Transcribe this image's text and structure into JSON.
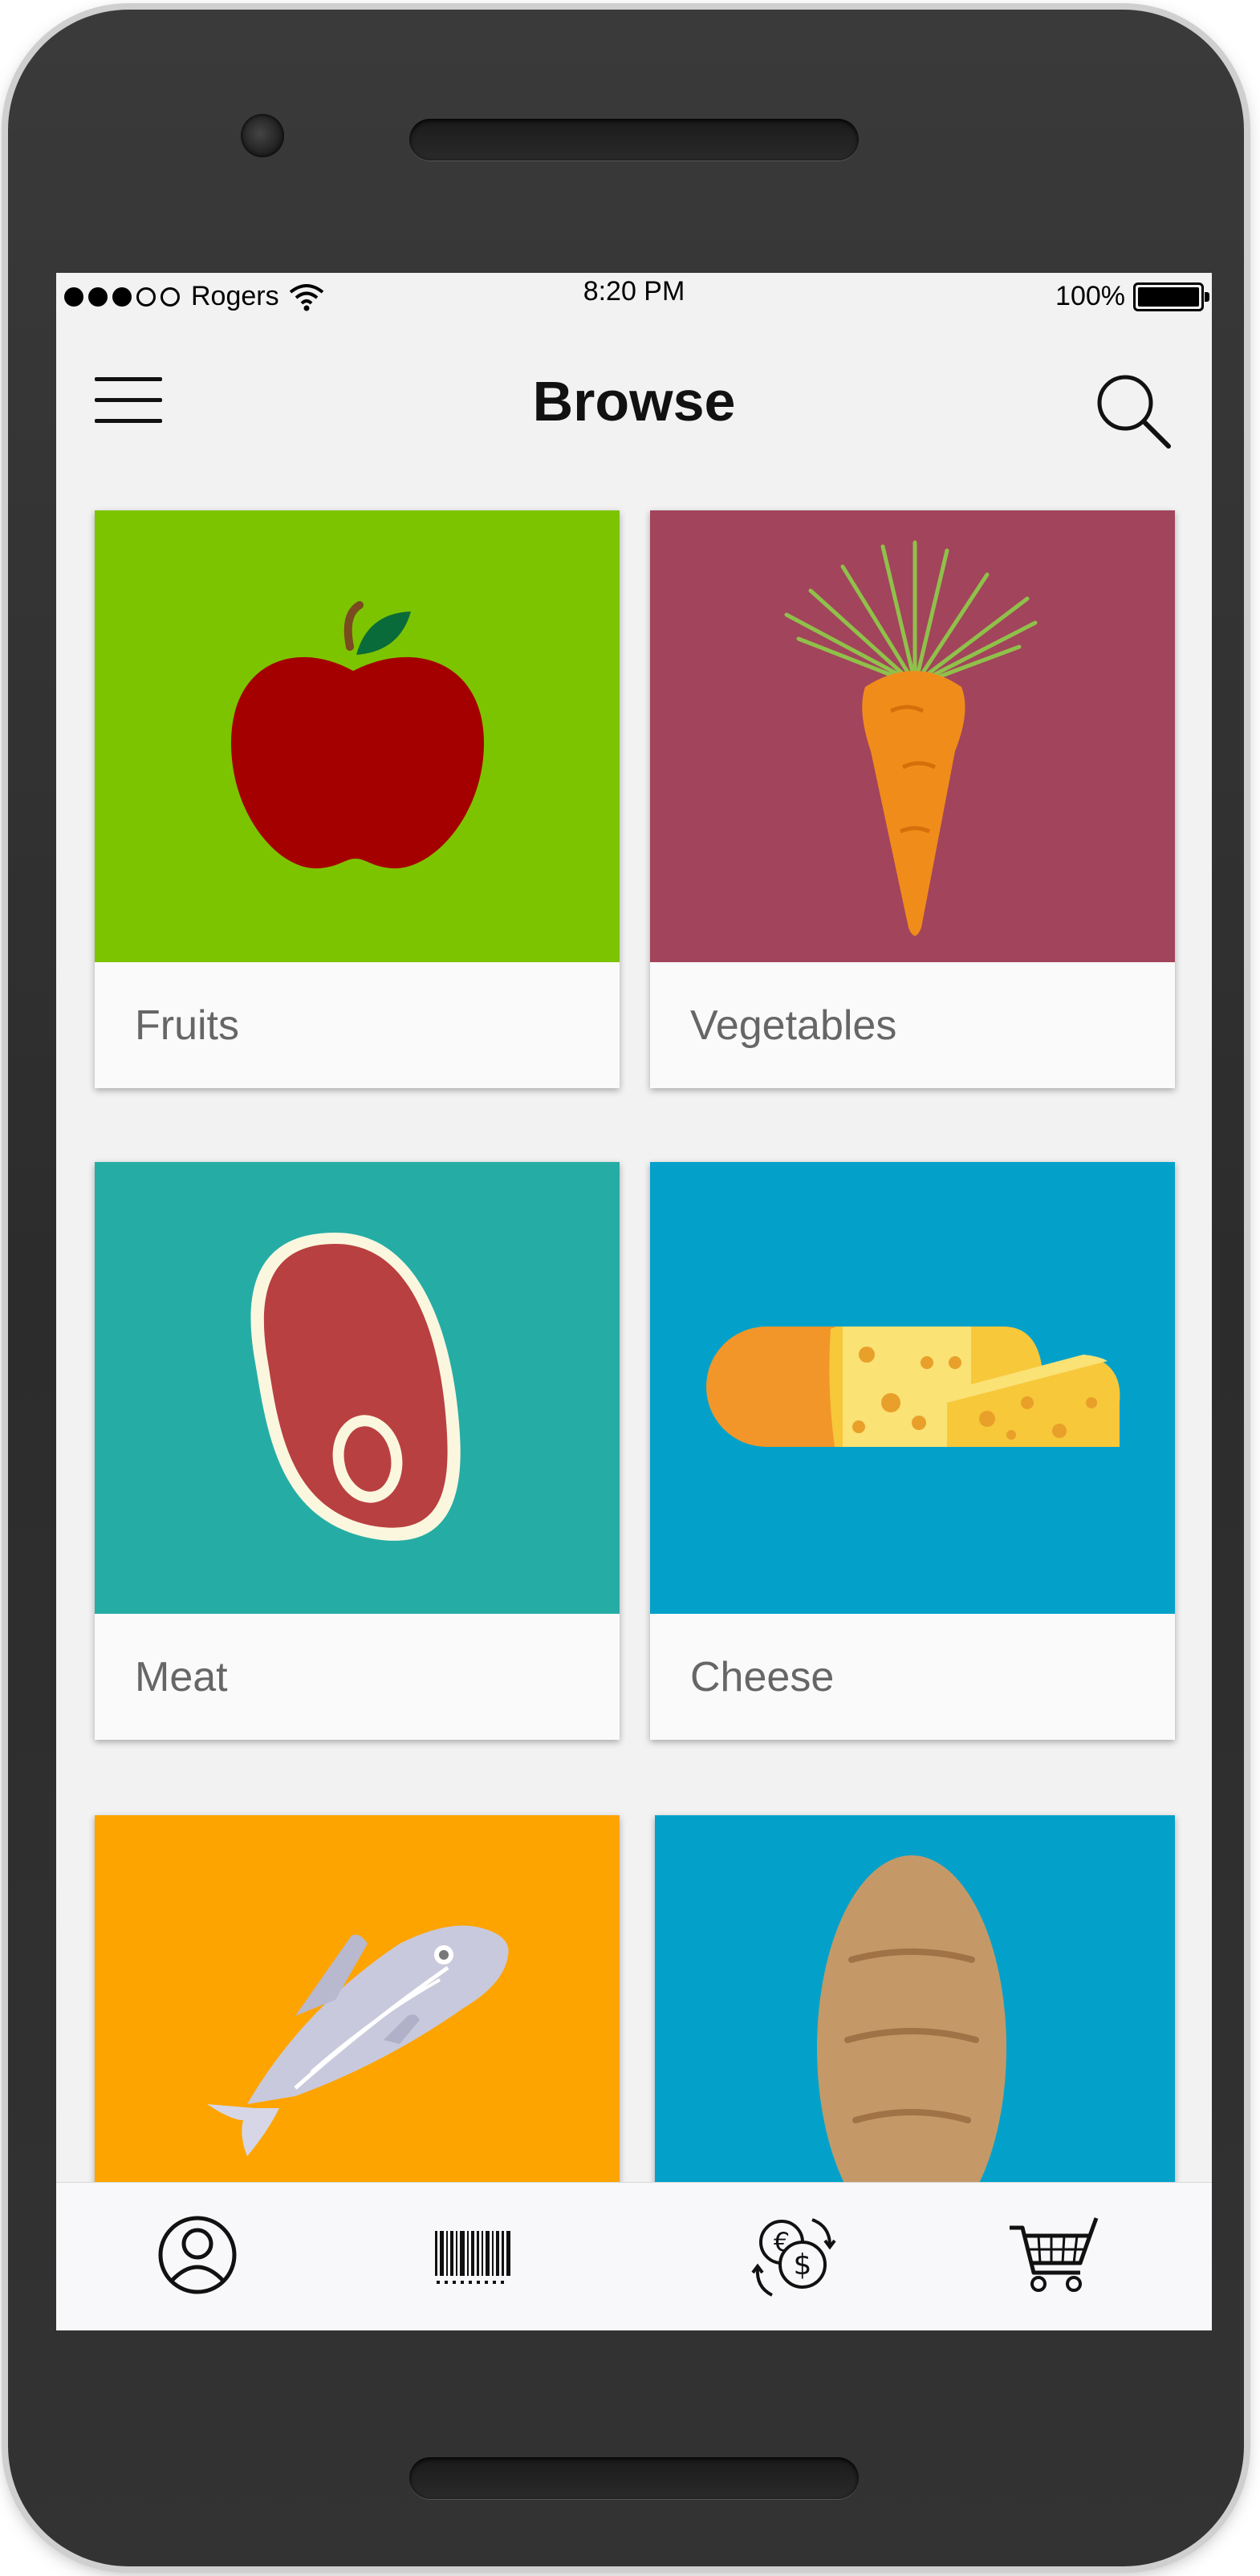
{
  "status_bar": {
    "carrier": "Rogers",
    "time": "8:20 PM",
    "battery": "100%",
    "signal_bars_filled": 3,
    "signal_bars_total": 5
  },
  "header": {
    "title": "Browse",
    "menu_icon": "hamburger-menu-icon",
    "search_icon": "search-icon"
  },
  "categories": [
    {
      "label": "Fruits",
      "color": "#7dc400",
      "icon": "apple-icon"
    },
    {
      "label": "Vegetables",
      "color": "#a2445c",
      "icon": "carrot-icon"
    },
    {
      "label": "Meat",
      "color": "#25ada5",
      "icon": "steak-icon"
    },
    {
      "label": "Cheese",
      "color": "#03a1ca",
      "icon": "cheese-icon"
    },
    {
      "label": "",
      "color": "#fda400",
      "icon": "fish-icon"
    },
    {
      "label": "",
      "color": "#03a1ca",
      "icon": "bread-icon"
    }
  ],
  "tab_bar": [
    {
      "icon": "profile-icon"
    },
    {
      "icon": "barcode-icon"
    },
    {
      "icon": "currency-exchange-icon"
    },
    {
      "icon": "shopping-cart-icon"
    }
  ]
}
